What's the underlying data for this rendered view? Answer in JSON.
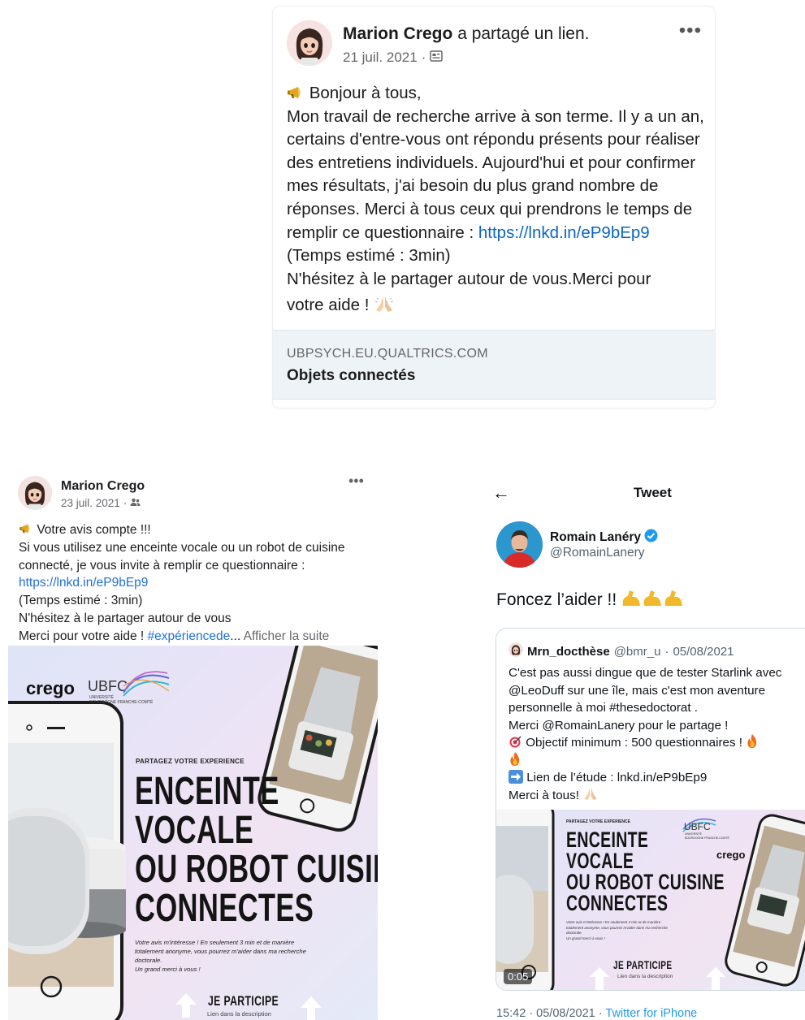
{
  "linkedin": {
    "author": "Marion Crego",
    "action": "a partagé un lien.",
    "date": "21 juil. 2021",
    "separator": "·",
    "more_label": "•••",
    "greeting": "Bonjour à tous,",
    "body_main": "Mon travail de recherche arrive à son terme. Il y a un an, certains d'entre-vous ont répondu présents pour réaliser des entretiens individuels. Aujourd'hui et pour confirmer mes résultats, j'ai besoin du plus grand nombre de réponses. Merci à tous ceux qui prendrons le temps de remplir ce questionnaire :",
    "link": "https://lnkd.in/eP9bEp9",
    "after_link": "(Temps estimé : 3min)",
    "share_line": "N'hésitez à le partager autour de vous.Merci pour",
    "closing": "votre aide !",
    "preview_domain": "UBPSYCH.EU.QUALTRICS.COM",
    "preview_title": "Objets connectés"
  },
  "facebook": {
    "author": "Marion Crego",
    "date": "23 juil. 2021",
    "separator": "·",
    "more_label": "•••",
    "line1": "Votre avis compte !!!",
    "line2": "Si vous utilisez une enceinte vocale ou un robot de cuisine connecté, je vous invite à remplir ce questionnaire :",
    "link": "https://lnkd.in/eP9bEp9",
    "line3": "(Temps estimé : 3min)",
    "line4": "N'hésitez à le partager autour de vous",
    "line5": "Merci pour votre aide !",
    "hashtag": "#expériencede",
    "ellipsis": "...",
    "see_more": "Afficher la suite"
  },
  "creative": {
    "brand_crego": "crego",
    "brand_ubfc": "UBFC",
    "ubfc_sub1": "UNIVERSITÉ",
    "ubfc_sub2": "BOURGOGNE FRANCHE-COMTÉ",
    "kicker": "PARTAGEZ VOTRE EXPERIENCE",
    "headline1": "ENCEINTE",
    "headline2": "VOCALE",
    "headline3": "OU ROBOT CUISINE",
    "headline4": "CONNECTES",
    "desc1": "Votre avis m'intéresse ! En seulement 3 min et de manière",
    "desc2": "totalement anonyme, vous pourrez m'aider dans ma recherche",
    "desc3": "doctorale.",
    "desc4": "Un grand merci à vous !",
    "cta": "JE PARTICIPE",
    "cta_sub": "Lien dans la description"
  },
  "twitter": {
    "header_title": "Tweet",
    "back_label": "←",
    "author": "Romain Lanéry",
    "handle": "@RomainLanery",
    "text": "Foncez l’aider !!",
    "quoted": {
      "author": "Mrn_docthèse",
      "handle": "@bmr_u",
      "separator": "·",
      "date": "05/08/2021",
      "line1": "C'est pas aussi dingue que de tester Starlink avec @LeoDuff sur une île, mais c'est mon aventure personnelle à moi #thesedoctorat .",
      "line2": "Merci @RomainLanery pour le partage !",
      "line3": "Objectif minimum : 500 questionnaires !",
      "line4": "Lien de l’étude : lnkd.in/eP9bEp9",
      "line5": "Merci à tous!",
      "video_time": "0:05"
    },
    "footer_time": "15:42 · 05/08/2021 ·",
    "footer_source": "Twitter for iPhone"
  }
}
